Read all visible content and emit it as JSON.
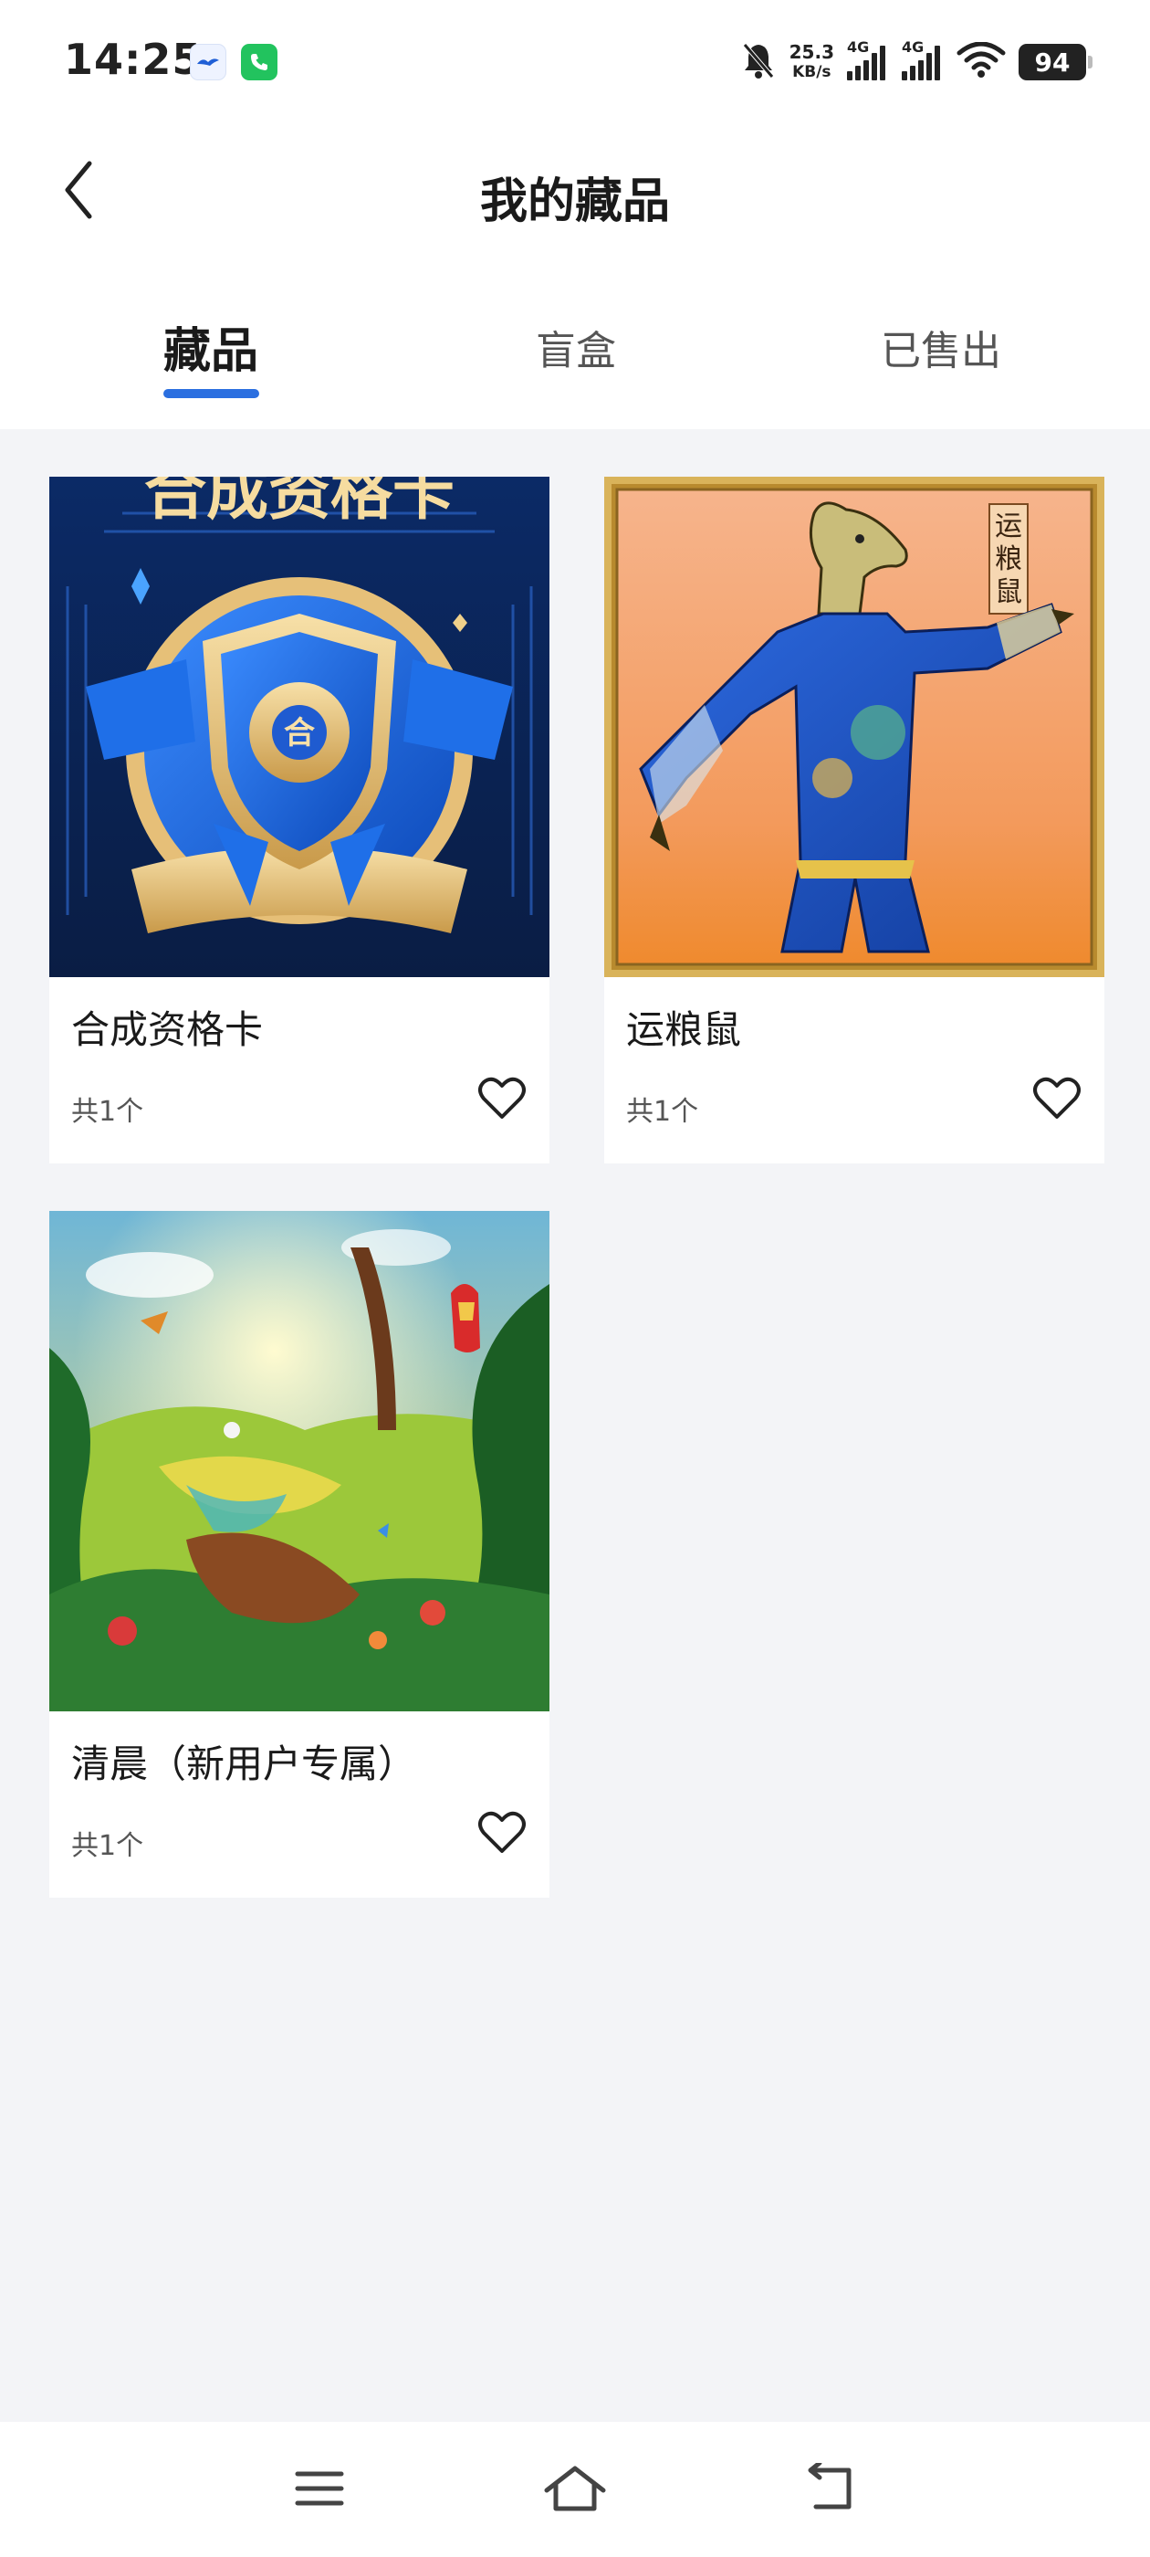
{
  "status_bar": {
    "time": "14:25",
    "net_speed_value": "25.3",
    "net_speed_unit": "KB/s",
    "signal_1_label": "4G",
    "signal_2_label": "4G",
    "battery": "94",
    "icons": [
      "bird-app-icon",
      "phone-app-icon",
      "bell-muted-icon",
      "signal-icon",
      "signal-icon",
      "wifi-icon",
      "battery-icon"
    ]
  },
  "header": {
    "title": "我的藏品",
    "back_icon": "chevron-left-icon"
  },
  "tabs": [
    {
      "label": "藏品",
      "active": true
    },
    {
      "label": "盲盒",
      "active": false
    },
    {
      "label": "已售出",
      "active": false
    }
  ],
  "accent_color": "#2b6fe0",
  "collections": [
    {
      "name": "合成资格卡",
      "count": "共1个",
      "image_text": "合成资格卡"
    },
    {
      "name": "运粮鼠",
      "count": "共1个",
      "image_text": "运粮鼠"
    },
    {
      "name": "清晨（新用户专属）",
      "count": "共1个"
    }
  ],
  "nav_bar": {
    "icons": [
      "menu-icon",
      "home-icon",
      "back-arrow-icon"
    ]
  }
}
